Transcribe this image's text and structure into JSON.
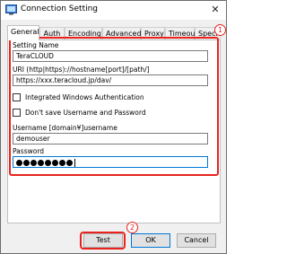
{
  "window": {
    "title": "Connection Setting",
    "close_glyph": "✕"
  },
  "tabs": [
    {
      "label": "General",
      "active": true
    },
    {
      "label": "Auth"
    },
    {
      "label": "Encoding"
    },
    {
      "label": "Advanced"
    },
    {
      "label": "Proxy"
    },
    {
      "label": "Timeout"
    },
    {
      "label": "Special"
    }
  ],
  "form": {
    "setting_name_label": "Setting Name",
    "setting_name_value": "TeraCLOUD",
    "uri_label": "URI (http|https)://hostname[port]/[path/]",
    "uri_value": "https://xxx.teracloud.jp/dav/",
    "integrated_auth_label": "Integrated Windows Authentication",
    "integrated_auth_checked": false,
    "dont_save_label": "Don't save Username and Password",
    "dont_save_checked": false,
    "username_label": "Username  [domain¥]username",
    "username_value": "demouser",
    "password_label": "Password",
    "password_mask_count": 8
  },
  "buttons": {
    "test": "Test",
    "ok": "OK",
    "cancel": "Cancel"
  },
  "annotations": {
    "badge1": "1",
    "badge2": "2"
  },
  "colors": {
    "annotation_red": "#e8231e",
    "focus_blue": "#0078d7"
  },
  "icons": {
    "app": "connection-icon"
  }
}
